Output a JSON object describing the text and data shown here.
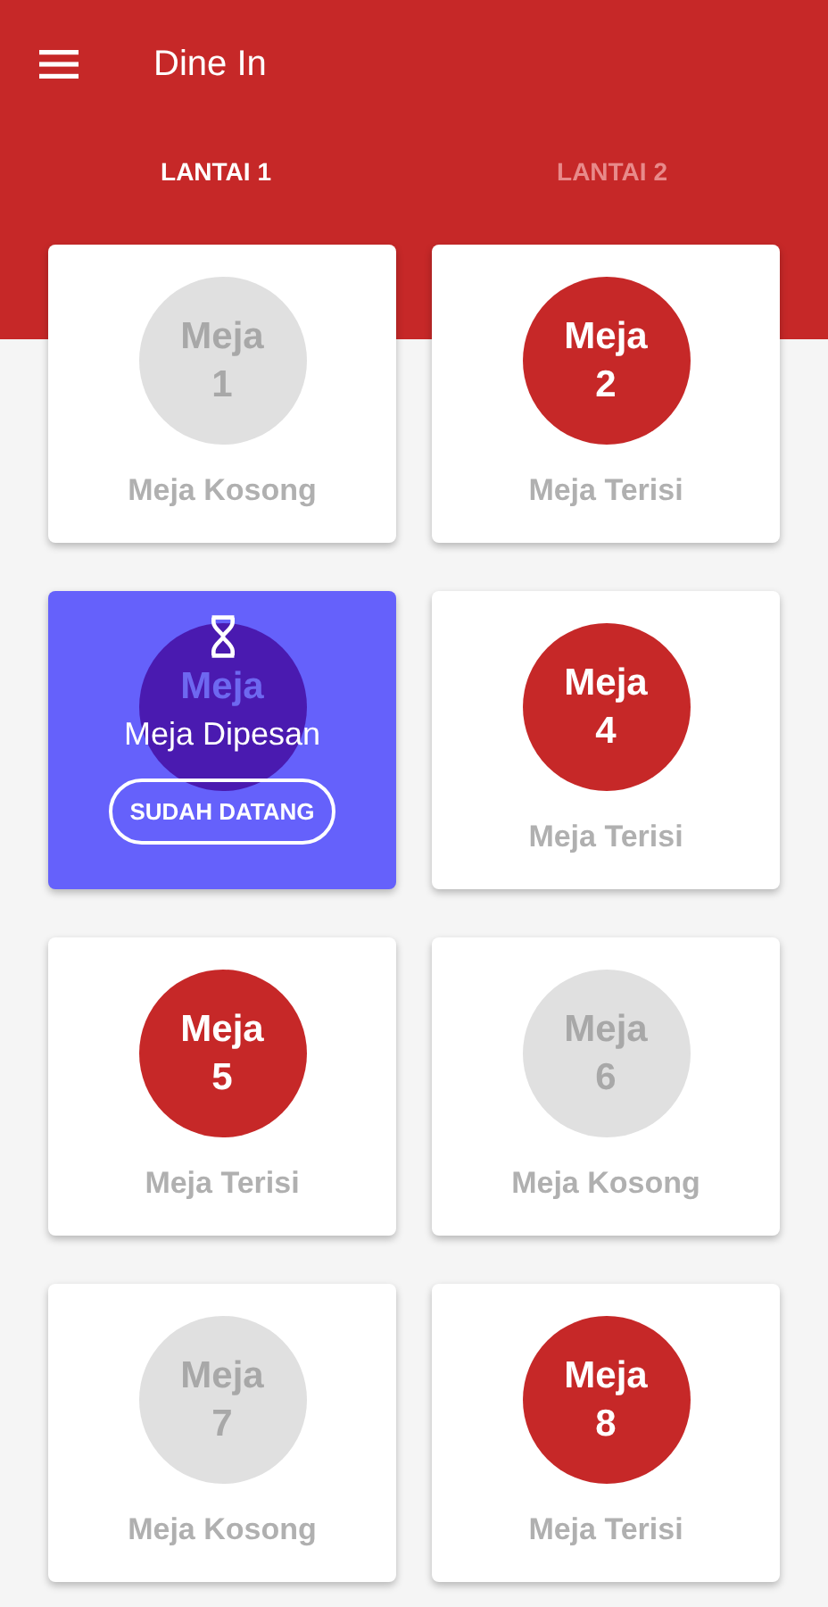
{
  "app_bar": {
    "title": "Dine In"
  },
  "tabs": [
    {
      "label": "LANTAI 1",
      "selected": true
    },
    {
      "label": "LANTAI 2",
      "selected": false
    }
  ],
  "tables": [
    {
      "kind": "empty",
      "name": "Meja",
      "number": "1",
      "status": "Meja Kosong"
    },
    {
      "kind": "occupied",
      "name": "Meja",
      "number": "2",
      "status": "Meja Terisi"
    },
    {
      "kind": "reserved",
      "name": "Meja",
      "status": "Meja Dipesan",
      "button": "SUDAH DATANG"
    },
    {
      "kind": "occupied",
      "name": "Meja",
      "number": "4",
      "status": "Meja Terisi"
    },
    {
      "kind": "occupied",
      "name": "Meja",
      "number": "5",
      "status": "Meja Terisi"
    },
    {
      "kind": "empty",
      "name": "Meja",
      "number": "6",
      "status": "Meja Kosong"
    },
    {
      "kind": "empty",
      "name": "Meja",
      "number": "7",
      "status": "Meja Kosong"
    },
    {
      "kind": "occupied",
      "name": "Meja",
      "number": "8",
      "status": "Meja Terisi"
    }
  ]
}
